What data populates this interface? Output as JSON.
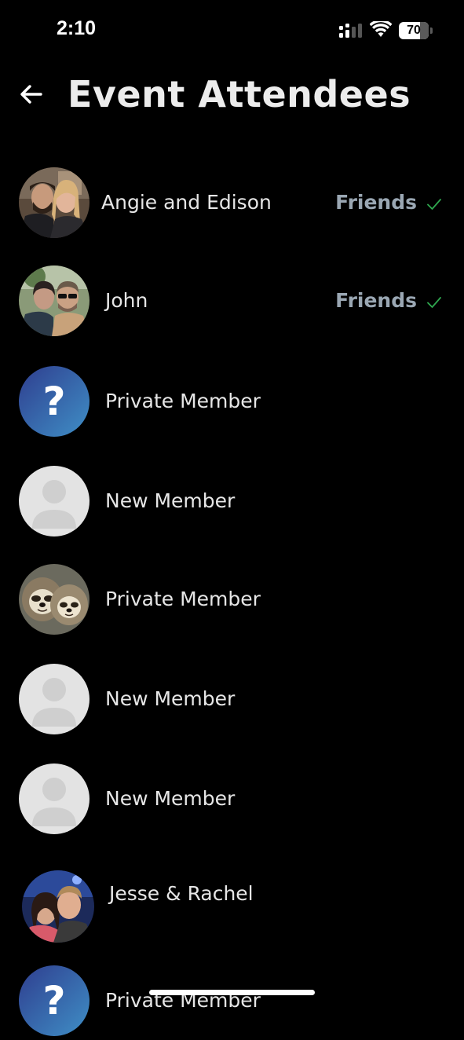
{
  "status_bar": {
    "time": "2:10",
    "battery_level": "70",
    "battery_fraction": 0.7,
    "signal_icon": "cellular-signal-icon",
    "wifi_icon": "wifi-icon"
  },
  "header": {
    "back_icon": "back-arrow-icon",
    "title": "Event Attendees"
  },
  "colors": {
    "background": "#000000",
    "friends_label": "#9aa7b3",
    "check": "#2fa84f",
    "private_avatar_gradient": [
      "#2f3e8f",
      "#3f8fc6"
    ],
    "placeholder_avatar": "#e3e3e3"
  },
  "attendees": [
    {
      "name": "Angie and Edison",
      "avatar": "couple-photo-avatar",
      "status": "Friends",
      "status_icon": "checkmark-icon"
    },
    {
      "name": "John",
      "avatar": "couple-photo-avatar",
      "status": "Friends",
      "status_icon": "checkmark-icon"
    },
    {
      "name": "Private Member",
      "avatar": "question-mark-avatar"
    },
    {
      "name": "New Member",
      "avatar": "default-person-avatar"
    },
    {
      "name": "Private Member",
      "avatar": "sloth-photo-avatar"
    },
    {
      "name": "New Member",
      "avatar": "default-person-avatar"
    },
    {
      "name": "New Member",
      "avatar": "default-person-avatar"
    },
    {
      "name": "Jesse & Rachel",
      "avatar": "couple-photo-avatar"
    },
    {
      "name": "Private Member",
      "avatar": "question-mark-avatar"
    }
  ]
}
